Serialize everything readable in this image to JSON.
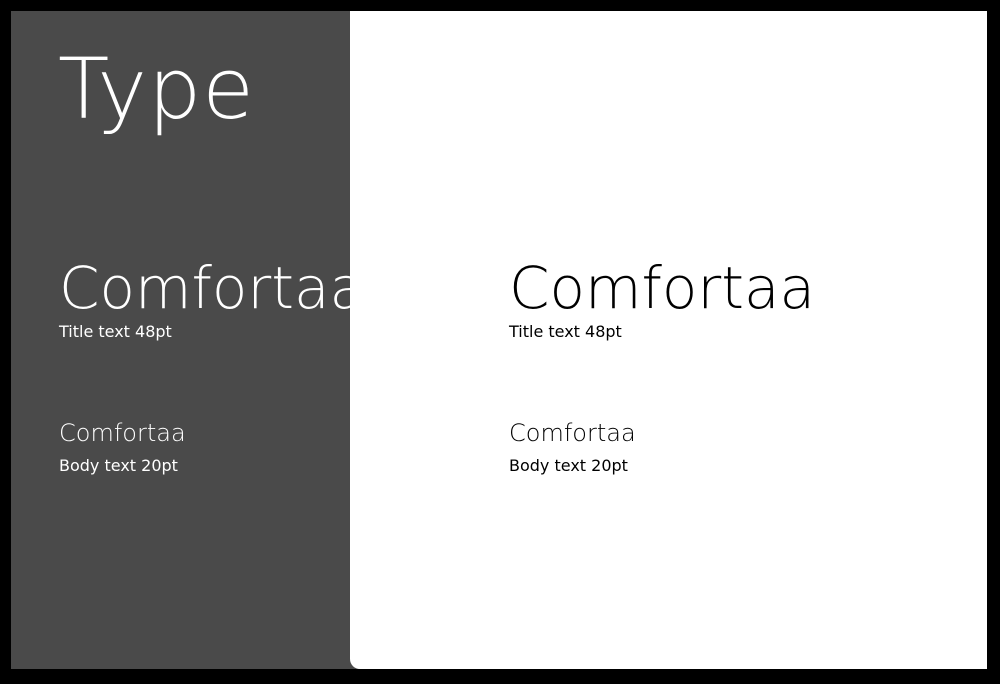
{
  "dark": {
    "heading": "Type",
    "title_sample": "Comfortaa",
    "title_caption": "Title text 48pt",
    "body_sample": "Comfortaa",
    "body_caption": "Body text 20pt"
  },
  "light": {
    "title_sample": "Comfortaa",
    "title_caption": "Title text 48pt",
    "body_sample": "Comfortaa",
    "body_caption": "Body text 20pt"
  },
  "colors": {
    "frame": "#000000",
    "dark_panel": "#4a4a4a",
    "light_panel": "#ffffff"
  }
}
